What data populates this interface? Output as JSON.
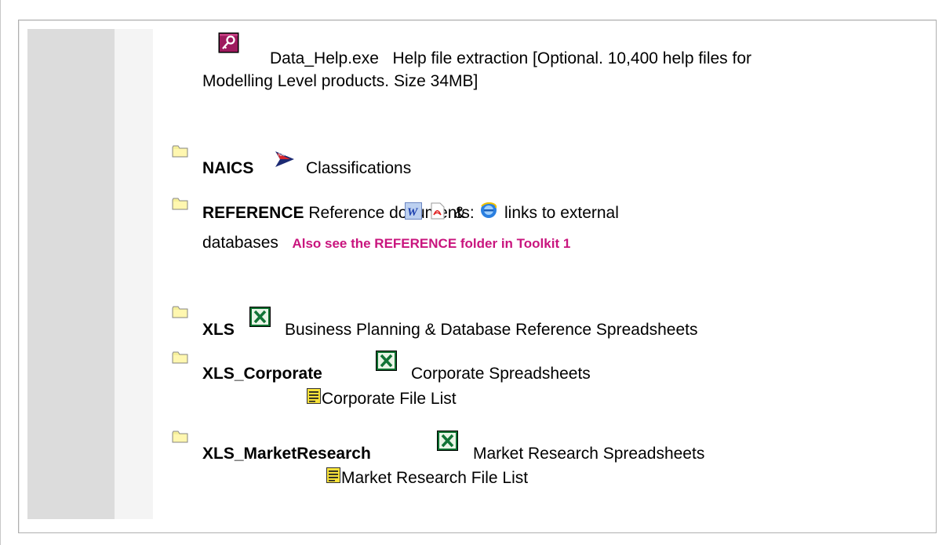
{
  "entries": {
    "data_help": {
      "filename": "Data_Help.exe",
      "desc_line1": "Help file extraction [Optional. 10,400 help files for",
      "desc_line2": "Modelling Level products. Size 34MB]"
    },
    "naics": {
      "name": "NAICS",
      "desc": "Classifications"
    },
    "reference": {
      "name": "REFERENCE",
      "desc_part1": "Reference documents:",
      "amp": "&",
      "desc_part2": "links to external",
      "desc_line2": "databases",
      "note": "Also see the REFERENCE folder in Toolkit 1"
    },
    "xls": {
      "name": "XLS",
      "desc": "Business Planning & Database Reference Spreadsheets"
    },
    "xls_corporate": {
      "name": "XLS_Corporate",
      "desc": "Corporate Spreadsheets",
      "file_list": "Corporate File List"
    },
    "xls_market": {
      "name": "XLS_MarketResearch",
      "desc": "Market Research Spreadsheets",
      "file_list": "Market Research File List"
    }
  },
  "icons": [
    "key-exe-icon",
    "folder-icon",
    "naics-logo-icon",
    "word-doc-icon",
    "pdf-doc-icon",
    "ie-browser-icon",
    "excel-icon",
    "text-file-icon"
  ],
  "colors": {
    "note": "#c9157e",
    "sidebar": "#dcdcdc",
    "border": "#b0b0b0"
  }
}
